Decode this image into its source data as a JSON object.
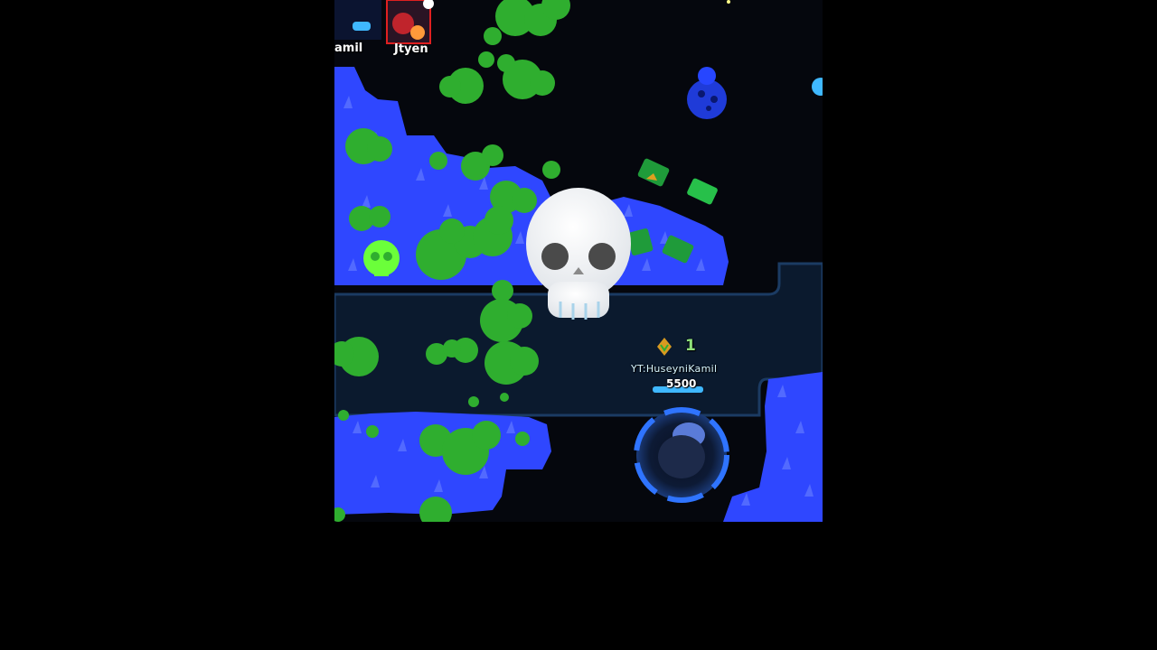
{
  "hud": {
    "left_player_name": "amil",
    "portrait_name": "Jtyen"
  },
  "player": {
    "kills": "1",
    "name": "YT:HuseyniKamil",
    "health": "5500"
  },
  "colors": {
    "background": "#000000",
    "map_dark": "#05070d",
    "lane": "#0b1a2e",
    "lane_border": "#1b3b63",
    "grass_blue": "#2f47ff",
    "bush_green": "#2fae2f",
    "player_ring": "#2f74ff",
    "health_bar": "#3fb8ff"
  },
  "icons": {
    "skull_emoji": "skull-icon",
    "kill": "kill-icon",
    "gem": "gem-icon",
    "blue_bot": "blue-creature-icon"
  }
}
